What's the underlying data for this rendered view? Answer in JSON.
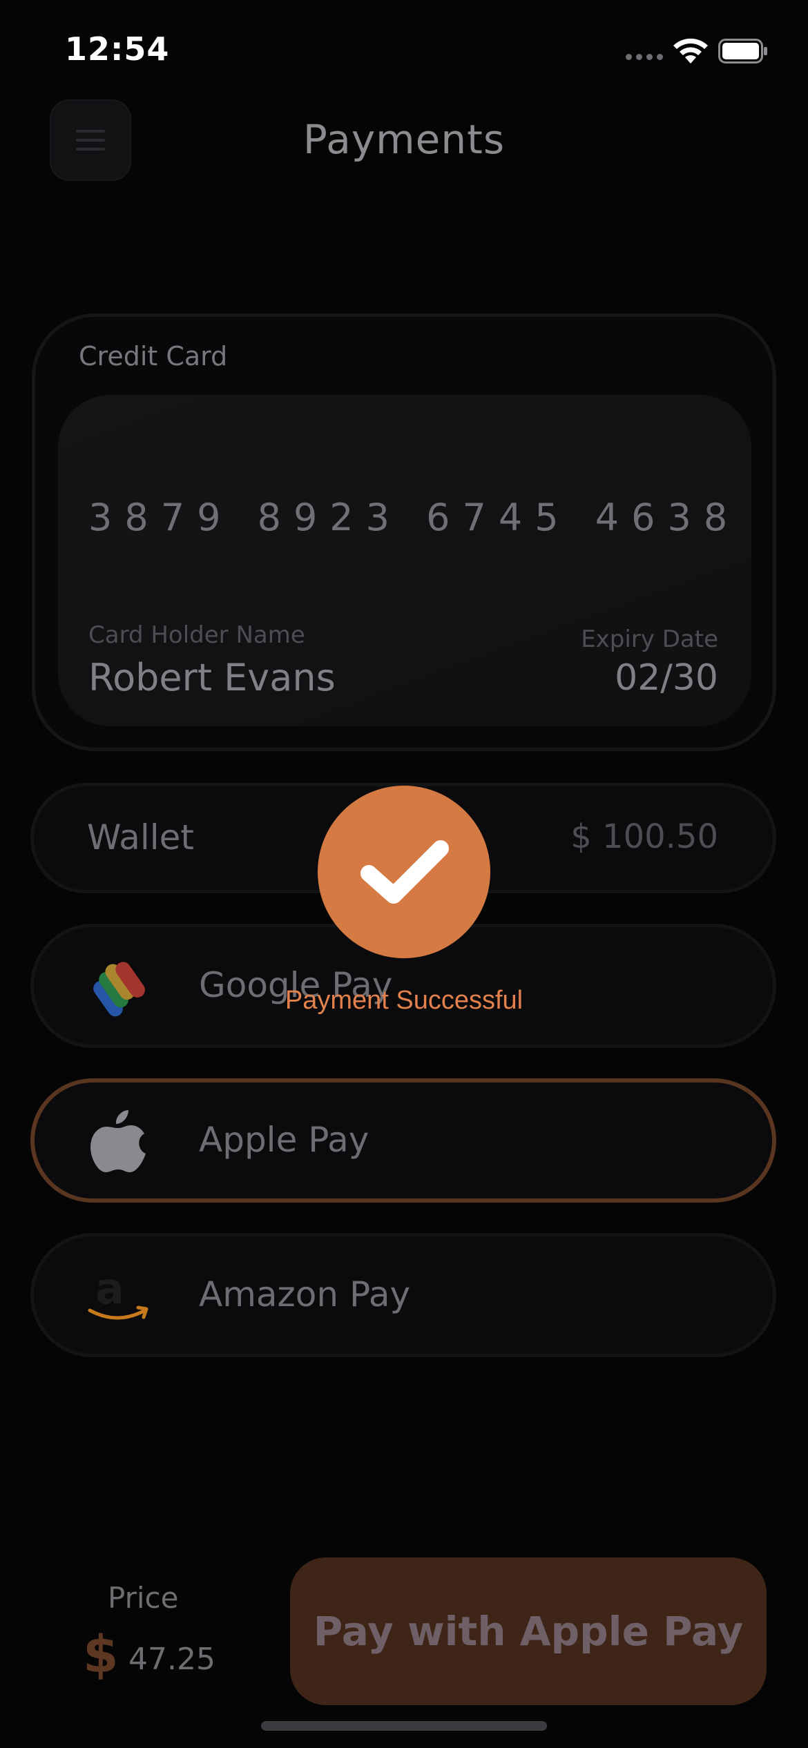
{
  "status_bar": {
    "time": "12:54"
  },
  "header": {
    "title": "Payments"
  },
  "credit_card": {
    "section_label": "Credit Card",
    "number": "3879 8923 6745 4638",
    "holder_label": "Card Holder Name",
    "holder_name": "Robert Evans",
    "expiry_label": "Expiry Date",
    "expiry_value": "02/30"
  },
  "payment_options": {
    "wallet": {
      "label": "Wallet",
      "amount": "$ 100.50"
    },
    "google_pay": {
      "label": "Google Pay",
      "icon": "google-pay-icon"
    },
    "apple_pay": {
      "label": "Apple Pay",
      "icon": "apple-icon",
      "selected": true
    },
    "amazon_pay": {
      "label": "Amazon Pay",
      "icon": "amazon-icon"
    }
  },
  "overlay": {
    "message": "Payment Successful",
    "icon": "checkmark-icon"
  },
  "footer": {
    "price_label": "Price",
    "currency_symbol": "$",
    "price_value": "47.25",
    "pay_button_label": "Pay with Apple Pay"
  },
  "colors": {
    "accent": "#d67a44",
    "background": "#050506",
    "selected_border": "#5a3620"
  }
}
